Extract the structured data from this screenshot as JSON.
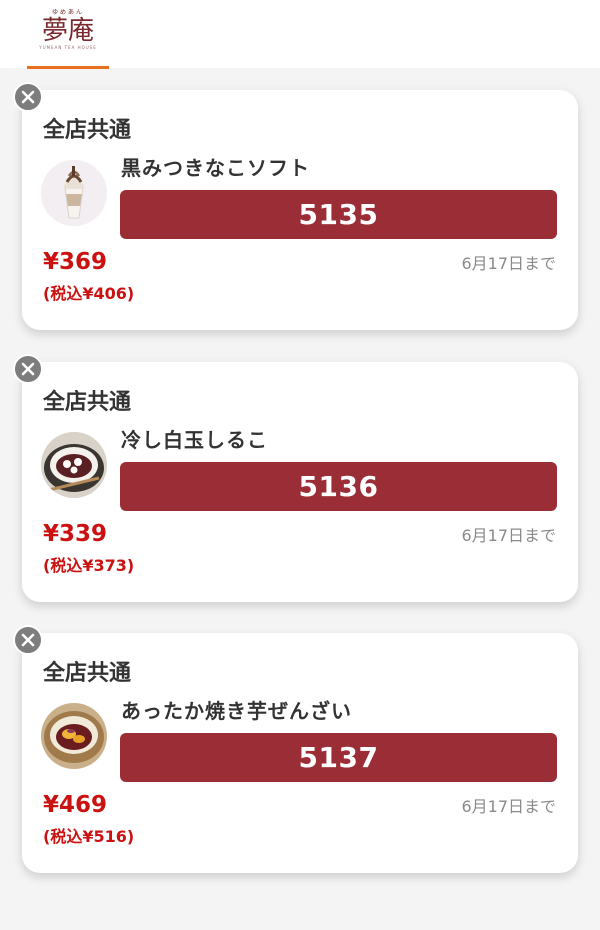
{
  "header": {
    "logo_small": "ゆめあん",
    "logo_main": "夢庵",
    "logo_tagline": "YUMEAN TEA HOUSE"
  },
  "colors": {
    "accent_underline": "#e86f1c",
    "code_bar": "#9b2d37",
    "price": "#cc1111",
    "close_button": "#7d7d7d"
  },
  "coupons": [
    {
      "store": "全店共通",
      "name": "黒みつきなこソフト",
      "code": "5135",
      "price": "¥369",
      "price_tax": "(税込¥406)",
      "expiry": "6月17日まで",
      "image": "soft-serve-image"
    },
    {
      "store": "全店共通",
      "name": "冷し白玉しるこ",
      "code": "5136",
      "price": "¥339",
      "price_tax": "(税込¥373)",
      "expiry": "6月17日まで",
      "image": "shiratama-shiruko-image"
    },
    {
      "store": "全店共通",
      "name": "あったか焼き芋ぜんざい",
      "code": "5137",
      "price": "¥469",
      "price_tax": "(税込¥516)",
      "expiry": "6月17日まで",
      "image": "yakiimo-zenzai-image"
    }
  ]
}
